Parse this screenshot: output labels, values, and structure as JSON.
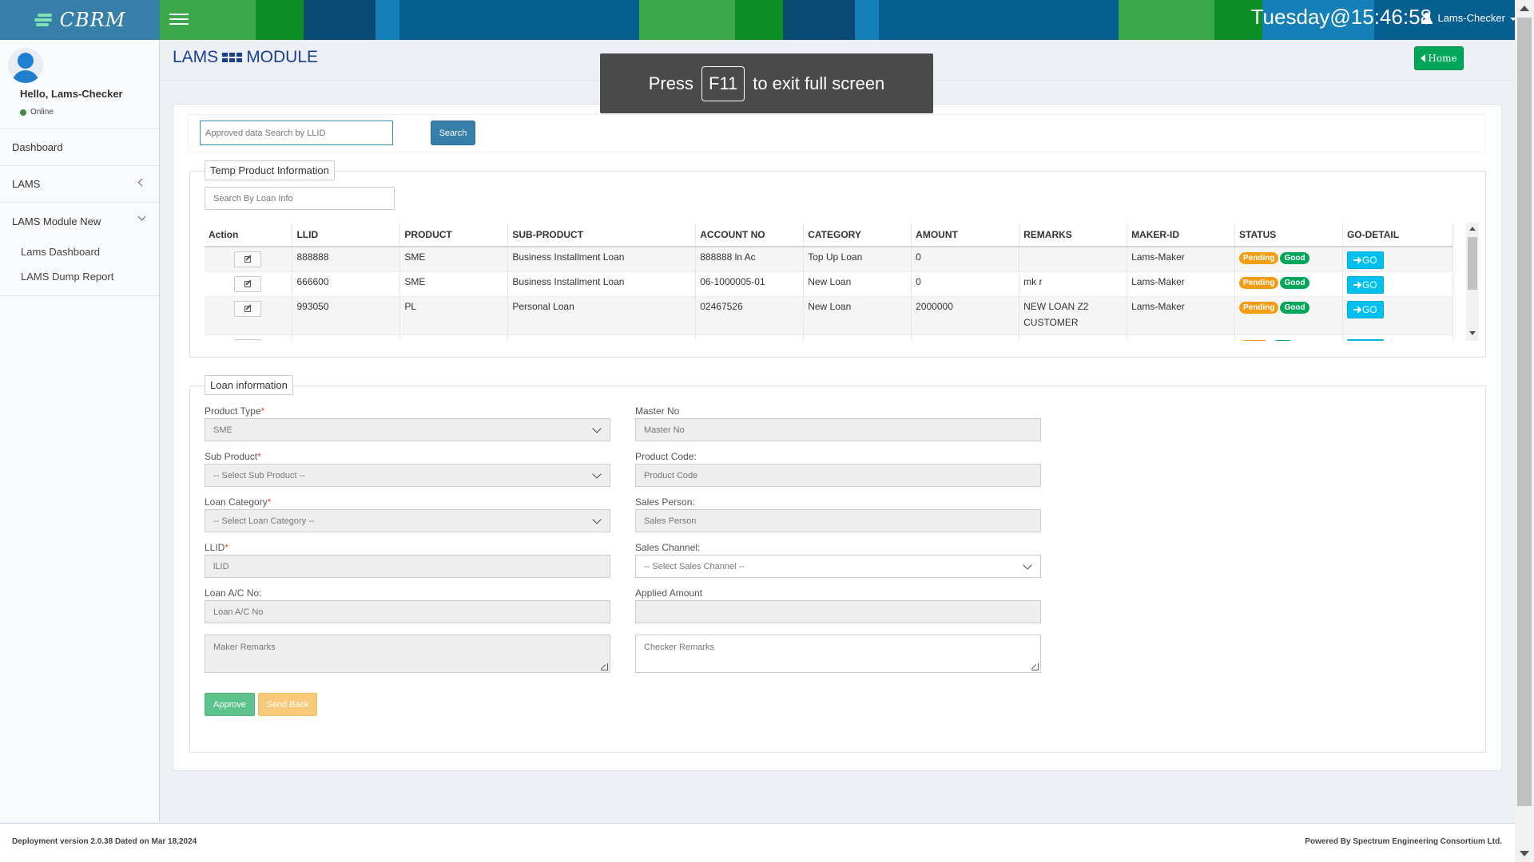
{
  "header": {
    "logo_text": "CBRM",
    "clock": "Tuesday@15:46:58",
    "user_menu_label": "Lams-Checker"
  },
  "sidebar": {
    "hello": "Hello, Lams-Checker",
    "status": "Online",
    "items": [
      {
        "label": "Dashboard"
      },
      {
        "label": "LAMS"
      },
      {
        "label": "LAMS Module New",
        "subitems": [
          {
            "label": "Lams Dashboard"
          },
          {
            "label": "LAMS Dump Report"
          }
        ]
      }
    ]
  },
  "page": {
    "title_left": "LAMS",
    "title_right": "MODULE",
    "home_label": "Home"
  },
  "fullscreen_toast": {
    "prefix": "Press",
    "key": "F11",
    "suffix": "to exit full screen"
  },
  "search": {
    "llid_placeholder": "Approved data Search by LLID",
    "button_label": "Search"
  },
  "temp_product": {
    "legend": "Temp Product Information",
    "search_placeholder": "Search By Loan Info",
    "columns": [
      "Action",
      "LLID",
      "PRODUCT",
      "SUB-PRODUCT",
      "ACCOUNT NO",
      "CATEGORY",
      "AMOUNT",
      "REMARKS",
      "MAKER-ID",
      "STATUS",
      "GO-DETAIL"
    ],
    "rows": [
      {
        "llid": "888888",
        "product": "SME",
        "sub_product": "Business Installment Loan",
        "account_no": "888888 ln Ac",
        "category": "Top Up Loan",
        "amount": "0",
        "remarks": "",
        "maker_id": "Lams-Maker",
        "status": "Pending",
        "quality": "Good",
        "go": "GO"
      },
      {
        "llid": "666600",
        "product": "SME",
        "sub_product": "Business Installment Loan",
        "account_no": "06-1000005-01",
        "category": "New Loan",
        "amount": "0",
        "remarks": "mk r",
        "maker_id": "Lams-Maker",
        "status": "Pending",
        "quality": "Good",
        "go": "GO"
      },
      {
        "llid": "993050",
        "product": "PL",
        "sub_product": "Personal Loan",
        "account_no": "02467526",
        "category": "New Loan",
        "amount": "2000000",
        "remarks": "NEW LOAN Z2 CUSTOMER",
        "maker_id": "Lams-Maker",
        "status": "Pending",
        "quality": "Good",
        "go": "GO"
      }
    ]
  },
  "loan_info": {
    "legend": "Loan information",
    "product_type": {
      "label": "Product Type",
      "value": "SME"
    },
    "sub_product": {
      "label": "Sub Product",
      "value": "-- Select Sub Product --"
    },
    "loan_category": {
      "label": "Loan Category",
      "value": "-- Select Loan Category --"
    },
    "llid": {
      "label": "LLID",
      "placeholder": "lLID"
    },
    "loan_ac_no": {
      "label": "Loan A/C No:",
      "placeholder": "Loan A/C No"
    },
    "maker_remarks": {
      "placeholder": "Maker Remarks"
    },
    "master_no": {
      "label": "Master No",
      "placeholder": "Master No"
    },
    "product_code": {
      "label": "Product Code:",
      "placeholder": "Product Code"
    },
    "sales_person": {
      "label": "Sales Person:",
      "placeholder": "Sales Person"
    },
    "sales_channel": {
      "label": "Sales Channel:",
      "value": "-- Select Sales Channel --"
    },
    "applied_amount": {
      "label": "Applied Amount",
      "value": ""
    },
    "checker_remarks": {
      "placeholder": "Checker Remarks"
    },
    "approve_label": "Approve",
    "send_back_label": "Send Back"
  },
  "footer": {
    "left": "Deployment version 2.0.38 Dated on Mar 18,2024",
    "right": "Powered By Spectrum Engineering Consortium Ltd."
  },
  "colors": {
    "header_blue": "#075f91",
    "header_green": "#3ca84a",
    "primary": "#367fa9",
    "success": "#00a65a",
    "warning": "#f39c12",
    "info": "#00c0ef",
    "title_blue": "#1b3f8f"
  }
}
